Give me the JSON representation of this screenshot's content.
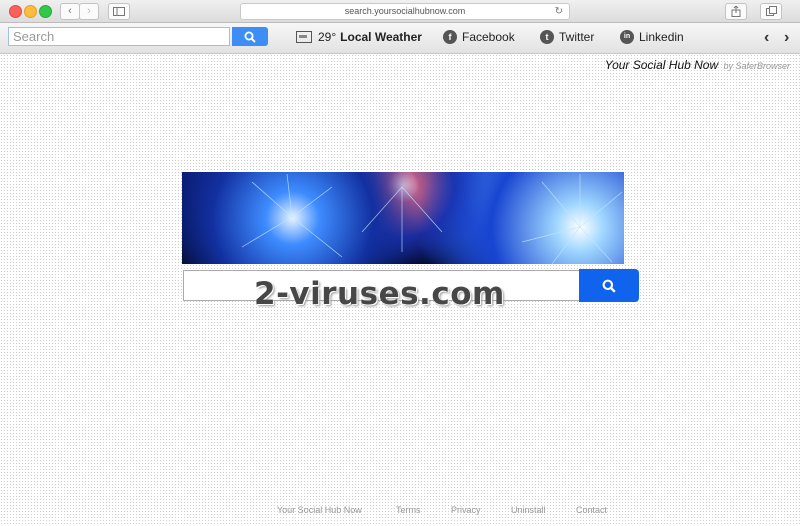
{
  "browser": {
    "url": "search.yoursocialhubnow.com",
    "nav": {
      "back": "‹",
      "forward": "›"
    }
  },
  "toolbar": {
    "search_placeholder": "Search",
    "search_button_icon": "search-icon",
    "weather": {
      "temp": "29°",
      "label": "Local Weather"
    },
    "links": [
      {
        "label": "Facebook",
        "icon": "facebook-icon",
        "glyph": "f"
      },
      {
        "label": "Twitter",
        "icon": "twitter-icon",
        "glyph": "t"
      },
      {
        "label": "Linkedin",
        "icon": "linkedin-icon",
        "glyph": "in"
      }
    ],
    "scroll_left": "‹",
    "scroll_right": "›"
  },
  "page": {
    "brand": "Your Social Hub Now",
    "brand_by": "by SaferBrowser",
    "main_search_placeholder": "",
    "watermark": "2-viruses.com"
  },
  "footer": {
    "links": [
      "Your Social Hub Now",
      "Terms",
      "Privacy",
      "Uninstall",
      "Contact"
    ]
  },
  "colors": {
    "accent": "#3c8ef4",
    "main_button": "#0f63ed"
  }
}
